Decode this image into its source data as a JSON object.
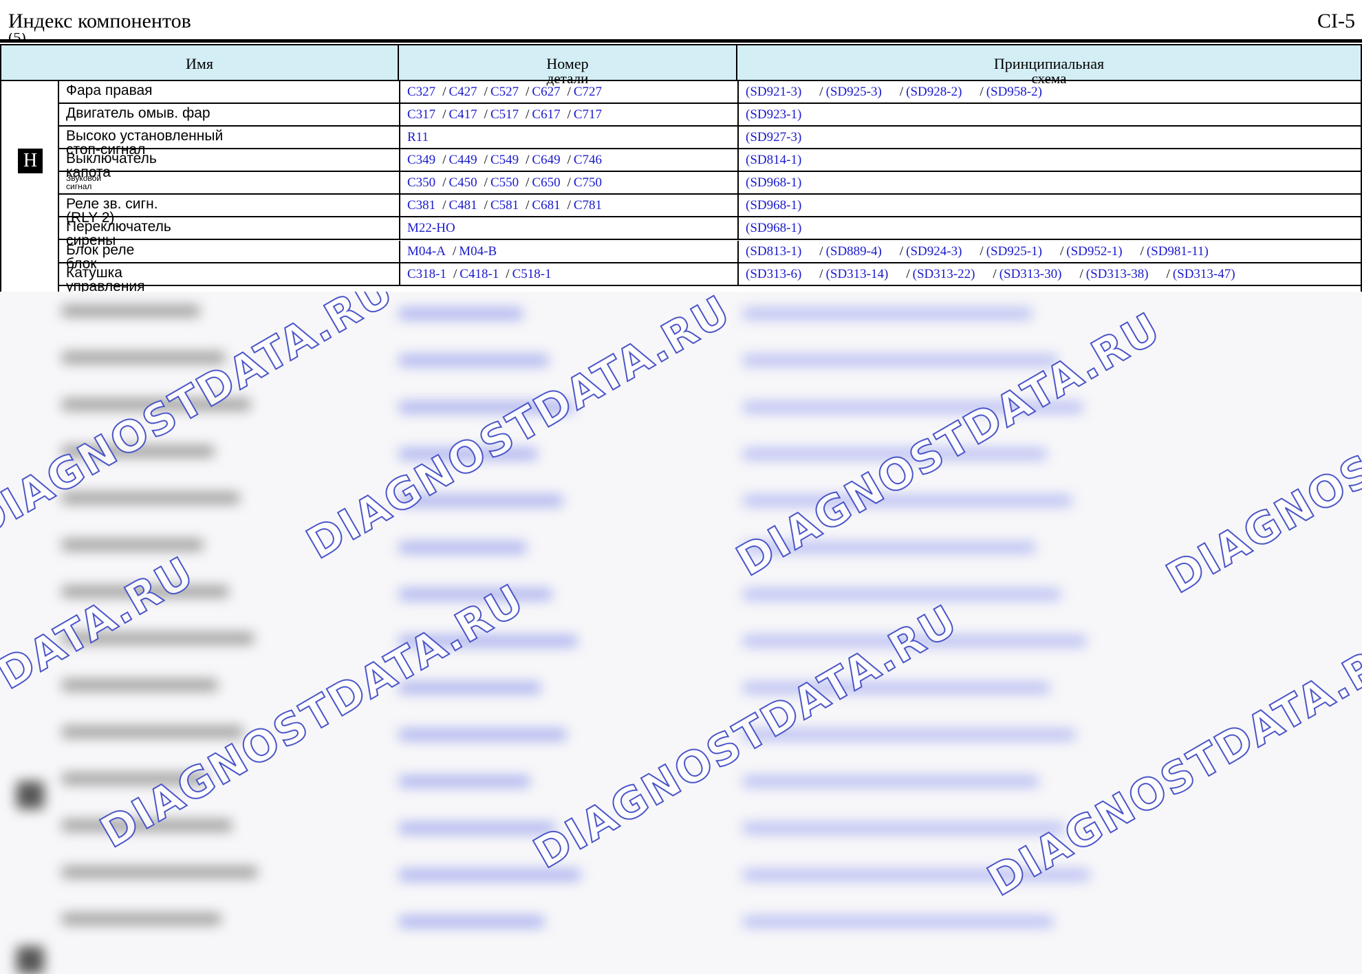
{
  "header": {
    "title": "Индекс компонентов",
    "subtitle": "(5)",
    "page": "CI-5"
  },
  "columns": {
    "name": "Имя",
    "part_line1": "Номер",
    "part_line2": "детали",
    "schema_line1": "Принципиальная",
    "schema_line2": "схема"
  },
  "section_h": {
    "letter": "H",
    "rows": [
      {
        "name1": "Фара правая",
        "name2": "",
        "parts": [
          "C327",
          "C427",
          "C527",
          "C627",
          "C727"
        ],
        "schemas": [
          "(SD921-3)",
          "(SD925-3)",
          "(SD928-2)",
          "(SD958-2)"
        ]
      },
      {
        "name1": "Двигатель омыв. фар",
        "name2": "",
        "parts": [
          "C317",
          "C417",
          "C517",
          "C617",
          "C717"
        ],
        "schemas": [
          "(SD923-1)"
        ]
      },
      {
        "name1": "Высоко установленный",
        "name2": "стоп-сигнал",
        "parts": [
          "R11"
        ],
        "schemas": [
          "(SD927-3)"
        ]
      },
      {
        "name1": "Выключатель",
        "name2": "капота",
        "parts": [
          "C349",
          "C449",
          "C549",
          "C649",
          "C746"
        ],
        "schemas": [
          "(SD814-1)"
        ]
      },
      {
        "name1": "Звуковой",
        "name2": "сигнал",
        "parts": [
          "C350",
          "C450",
          "C550",
          "C650",
          "C750"
        ],
        "schemas": [
          "(SD968-1)"
        ]
      },
      {
        "name1": "Реле зв. сигн.",
        "name2": "(RLY 2)",
        "parts": [
          "C381",
          "C481",
          "C581",
          "C681",
          "C781"
        ],
        "schemas": [
          "(SD968-1)"
        ]
      },
      {
        "name1": "Переключатель",
        "name2": "сирены",
        "parts": [
          "M22-HO"
        ],
        "schemas": [
          "(SD968-1)"
        ]
      }
    ]
  },
  "section_2": {
    "rows": [
      {
        "name1": "Блок реле",
        "name2": "блок",
        "parts": [
          "M04-A",
          "M04-B"
        ],
        "schemas": [
          "(SD813-1)",
          "(SD889-4)",
          "(SD924-3)",
          "(SD925-1)",
          "(SD952-1)",
          "(SD981-11)"
        ]
      },
      {
        "name1": "Катушка",
        "name2": "управления",
        "parts": [
          "C318-1",
          "C418-1",
          "C518-1"
        ],
        "schemas": [
          "(SD313-6)",
          "(SD313-14)",
          "(SD313-22)",
          "(SD313-30)",
          "(SD313-38)",
          "(SD313-47)"
        ]
      }
    ]
  },
  "watermark": "DIAGNOSTDATA.RU",
  "colors": {
    "header_bg": "#d4eef6",
    "link": "#1a1acc",
    "watermark_stroke": "#4b55c8"
  }
}
